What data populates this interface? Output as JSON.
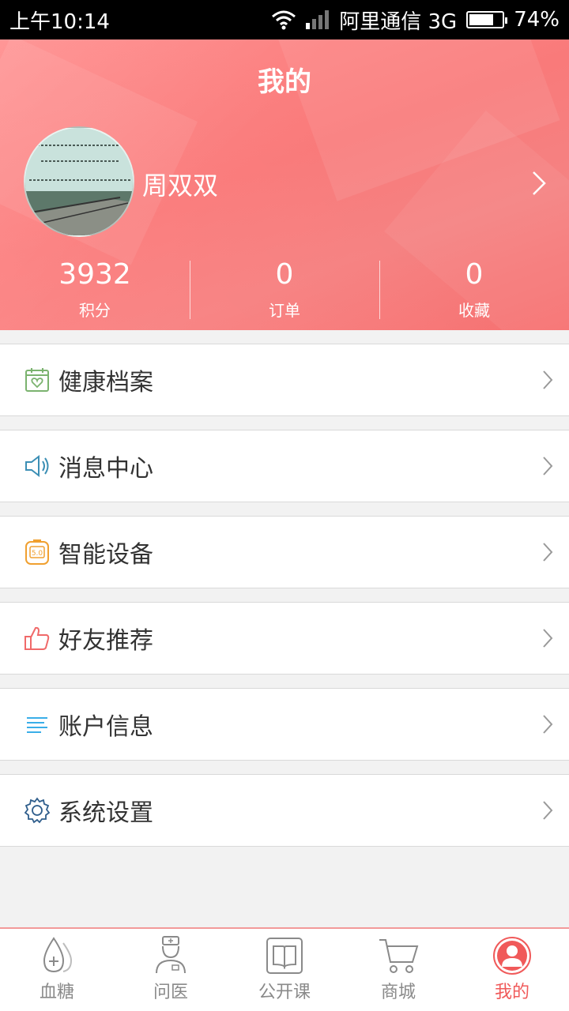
{
  "status_bar": {
    "time": "上午10:14",
    "carrier": "阿里通信 3G",
    "battery": "74%",
    "battery_level": 0.74
  },
  "header": {
    "title": "我的",
    "username": "周双双",
    "stats": [
      {
        "value": "3932",
        "label": "积分"
      },
      {
        "value": "0",
        "label": "订单"
      },
      {
        "value": "0",
        "label": "收藏"
      }
    ]
  },
  "menu": {
    "items": [
      {
        "label": "健康档案",
        "icon": "health-record-icon",
        "color": "#7bb36f"
      },
      {
        "label": "消息中心",
        "icon": "speaker-icon",
        "color": "#3c8fb5"
      },
      {
        "label": "智能设备",
        "icon": "device-icon",
        "color": "#f0a030"
      },
      {
        "label": "好友推荐",
        "icon": "thumbs-up-icon",
        "color": "#f06a6a"
      },
      {
        "label": "账户信息",
        "icon": "list-icon",
        "color": "#3aaee8"
      },
      {
        "label": "系统设置",
        "icon": "gear-icon",
        "color": "#2f5e8c"
      }
    ]
  },
  "tabbar": {
    "tabs": [
      {
        "label": "血糖",
        "icon": "blood-drop-icon"
      },
      {
        "label": "问医",
        "icon": "doctor-icon"
      },
      {
        "label": "公开课",
        "icon": "book-icon"
      },
      {
        "label": "商城",
        "icon": "cart-icon"
      },
      {
        "label": "我的",
        "icon": "person-icon",
        "active": true
      }
    ]
  },
  "colors": {
    "header": "#f97a7a",
    "active_tab": "#f05a5a"
  }
}
